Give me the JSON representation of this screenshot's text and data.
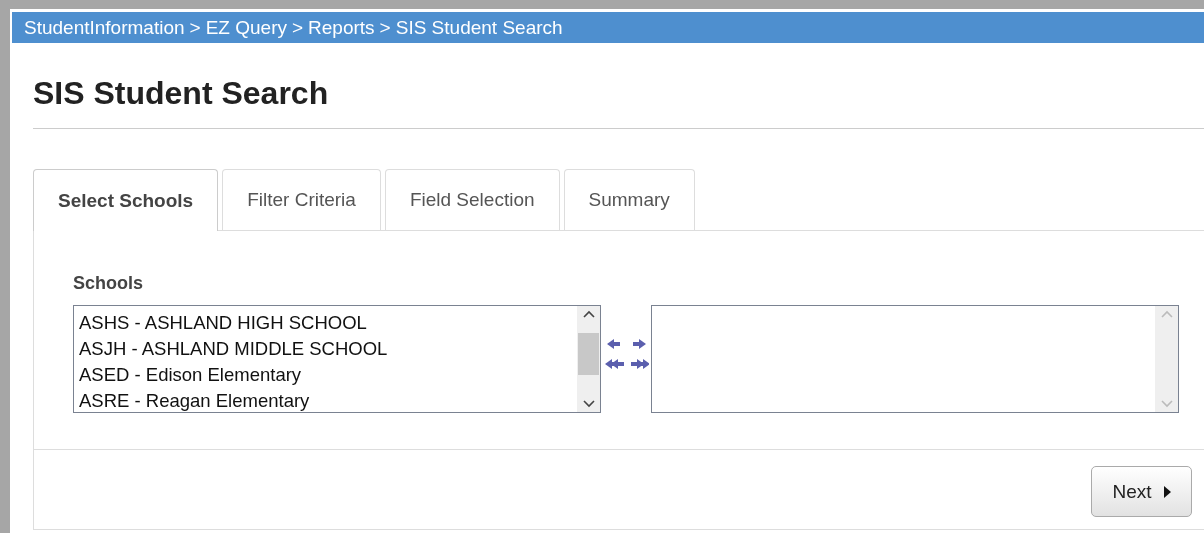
{
  "breadcrumb": [
    "StudentInformation",
    "EZ Query",
    "Reports",
    "SIS Student Search"
  ],
  "breadcrumb_separator": ">",
  "title": "SIS Student Search",
  "tabs": [
    {
      "label": "Select Schools",
      "selected": true
    },
    {
      "label": "Filter Criteria",
      "selected": false
    },
    {
      "label": "Field Selection",
      "selected": false
    },
    {
      "label": "Summary",
      "selected": false
    }
  ],
  "schools": {
    "label": "Schools",
    "available": [
      "ASHS - ASHLAND HIGH SCHOOL",
      "ASJH - ASHLAND MIDDLE SCHOOL",
      "ASED - Edison Elementary",
      "ASRE - Reagan Elementary"
    ]
  },
  "buttons": {
    "next": "Next"
  }
}
